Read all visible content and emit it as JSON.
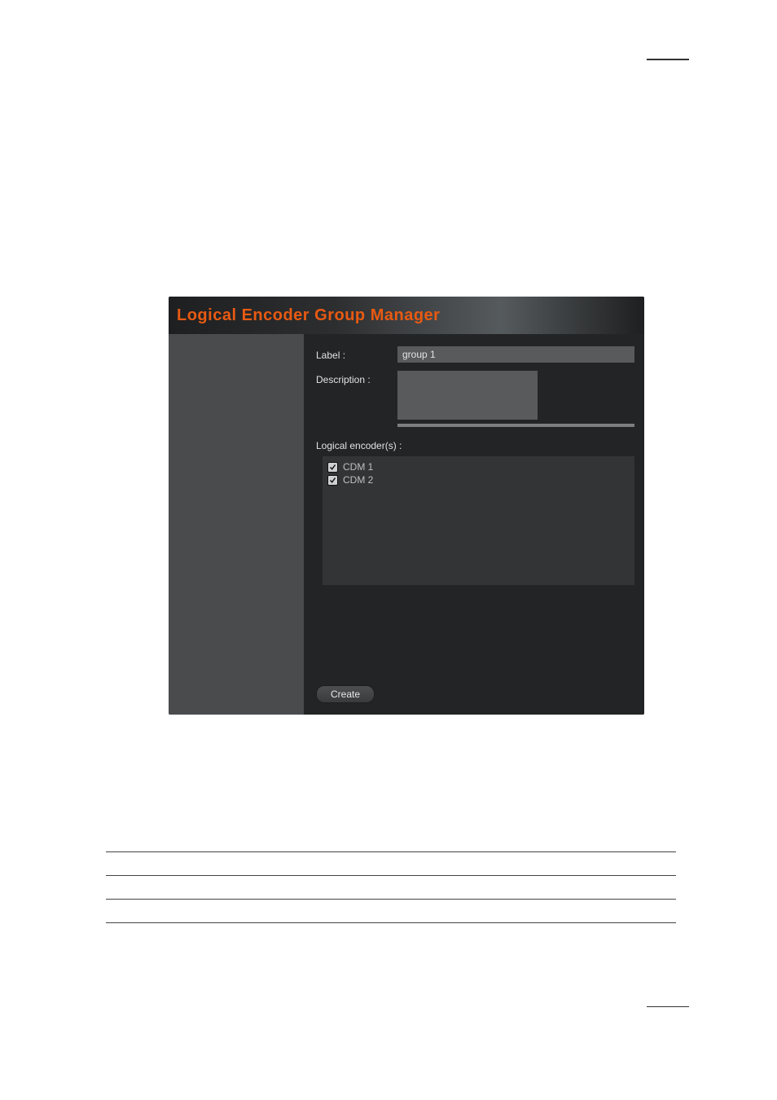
{
  "panel": {
    "title": "Logical Encoder Group Manager",
    "form": {
      "label_field_label": "Label :",
      "label_value": "group 1",
      "description_field_label": "Description :",
      "description_value": "",
      "encoders_field_label": "Logical encoder(s) :",
      "encoders": [
        {
          "label": "CDM 1",
          "checked": true
        },
        {
          "label": "CDM 2",
          "checked": true
        }
      ],
      "create_button": "Create"
    }
  }
}
